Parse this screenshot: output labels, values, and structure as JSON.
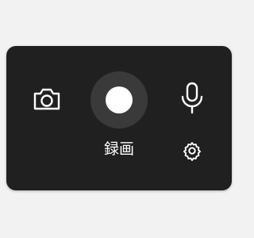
{
  "toolbar": {
    "record_label": "録画",
    "icons": {
      "camera": "camera-icon",
      "record": "record-icon",
      "microphone": "microphone-icon",
      "settings": "gear-icon"
    }
  },
  "colors": {
    "panel_background": "#202020",
    "record_ring": "#3a3a3a",
    "foreground": "#ffffff",
    "page_background": "#f2f2f2"
  }
}
